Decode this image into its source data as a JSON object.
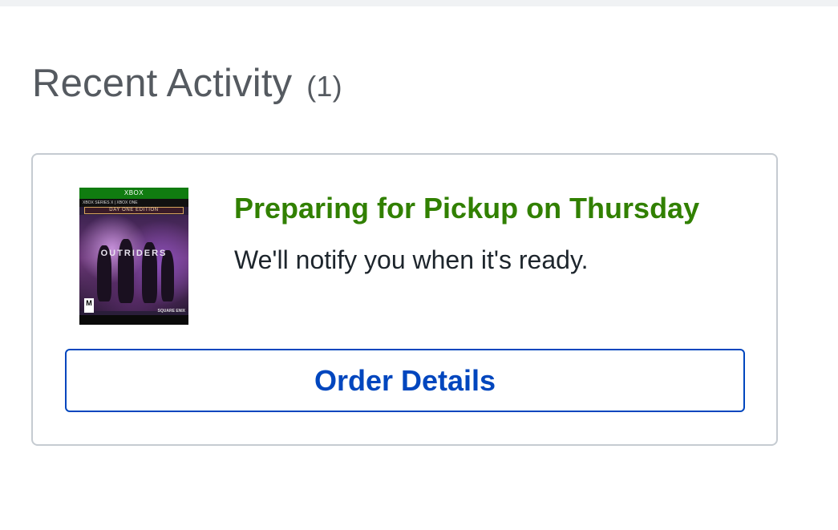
{
  "section": {
    "title": "Recent Activity",
    "count": "(1)"
  },
  "activity": {
    "status_title": "Preparing for Pickup on Thursday",
    "status_description": "We'll notify you when it's ready.",
    "order_button_label": "Order Details",
    "product_image": {
      "icon": "game-box-art",
      "brand_text": "XBOX",
      "platform_text": "XBOX SERIES X | XBOX ONE",
      "edition_text": "DAY ONE EDITION",
      "logo_text": "OUTRIDERS",
      "rating_text": "M",
      "publisher_text": "SQUARE ENIX"
    }
  },
  "colors": {
    "status_green": "#318000",
    "button_blue": "#0046be",
    "border_gray": "#c5cbd1",
    "heading_gray": "#555a60"
  }
}
